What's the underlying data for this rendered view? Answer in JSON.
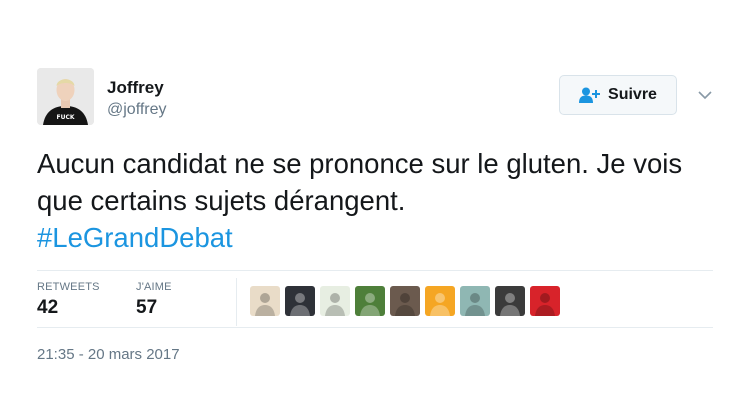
{
  "author": {
    "name": "Joffrey",
    "handle": "@joffrey",
    "shirt_text": "FUCK"
  },
  "follow_button": {
    "label": "Suivre",
    "icon": "person-add-icon"
  },
  "tweet": {
    "text": "Aucun candidat ne se prononce sur le gluten. Je vois que certains sujets dérangent.",
    "hashtag": "#LeGrandDebat"
  },
  "stats": {
    "retweets_label": "RETWEETS",
    "retweets_value": "42",
    "likes_label": "J'AIME",
    "likes_value": "57"
  },
  "likers": [
    {
      "name": "liker-avatar-1",
      "color": "#e9dcc8"
    },
    {
      "name": "liker-avatar-2",
      "color": "#2e3138"
    },
    {
      "name": "liker-avatar-3",
      "color": "#e7eee2"
    },
    {
      "name": "liker-avatar-4",
      "color": "#4e7f3a"
    },
    {
      "name": "liker-avatar-5",
      "color": "#6b5a4e"
    },
    {
      "name": "liker-avatar-6",
      "color": "#f5a623"
    },
    {
      "name": "liker-avatar-7",
      "color": "#8fb7b3"
    },
    {
      "name": "liker-avatar-8",
      "color": "#3b3b3b"
    },
    {
      "name": "liker-avatar-9",
      "color": "#d8232a"
    }
  ],
  "timestamp": "21:35 - 20 mars 2017",
  "colors": {
    "accent": "#1b95e0",
    "text": "#14171a",
    "muted": "#657786"
  }
}
